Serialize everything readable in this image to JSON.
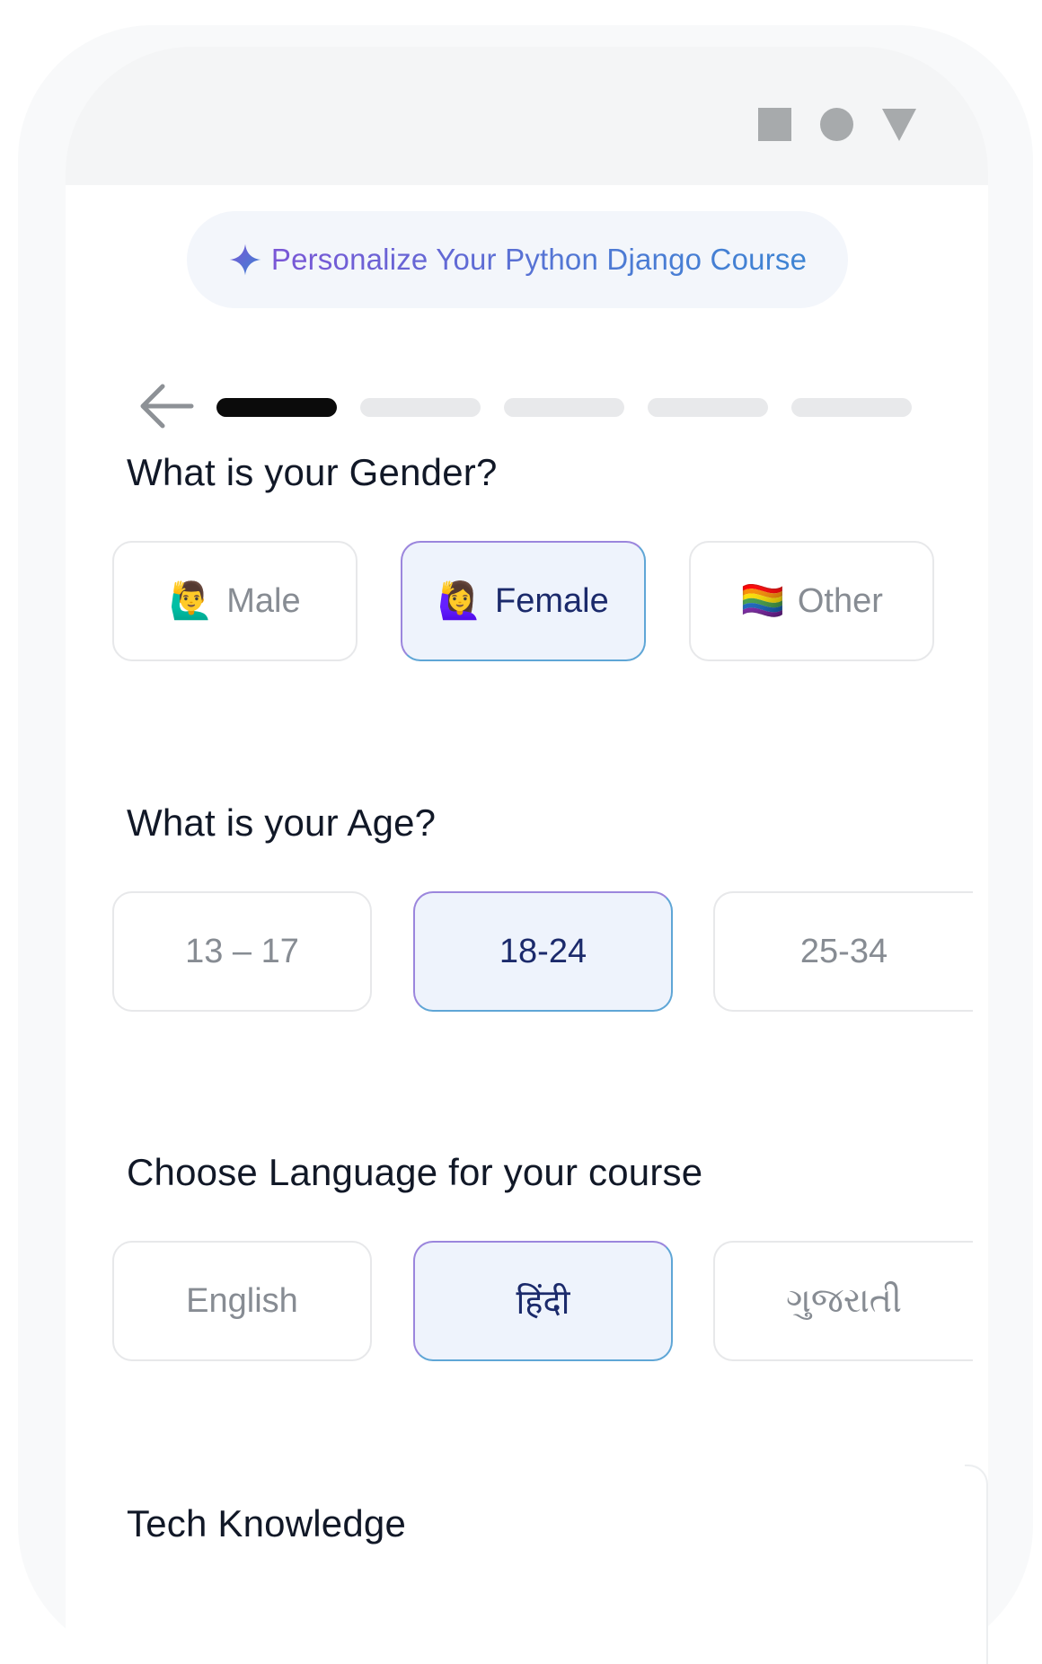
{
  "header": {
    "pill_label": "Personalize Your Python Django Course"
  },
  "progress": {
    "current_step": 1,
    "total_steps": 5
  },
  "questions": [
    {
      "title": "What is your Gender?",
      "options": [
        {
          "emoji": "🙋‍♂️",
          "label": "Male",
          "selected": false
        },
        {
          "emoji": "🙋‍♀️",
          "label": "Female",
          "selected": true
        },
        {
          "emoji": "🏳️‍🌈",
          "label": "Other",
          "selected": false
        }
      ]
    },
    {
      "title": "What is your Age?",
      "options": [
        {
          "label": "13 – 17",
          "selected": false
        },
        {
          "label": "18-24",
          "selected": true
        },
        {
          "label": "25-34",
          "selected": false
        }
      ]
    },
    {
      "title": "Choose Language for your course",
      "options": [
        {
          "label": "English",
          "selected": false
        },
        {
          "label": "हिंदी",
          "selected": true
        },
        {
          "label": "ગુજરાતી",
          "selected": false
        }
      ]
    },
    {
      "title": "Tech Knowledge"
    }
  ],
  "status_bar": {
    "icons": [
      "square-icon",
      "circle-icon",
      "triangle-icon"
    ]
  },
  "colors": {
    "accent_purple": "#7a56d6",
    "accent_blue": "#3d84d3",
    "selected_bg": "#eef3fc",
    "selected_text": "#1b2a6b"
  }
}
